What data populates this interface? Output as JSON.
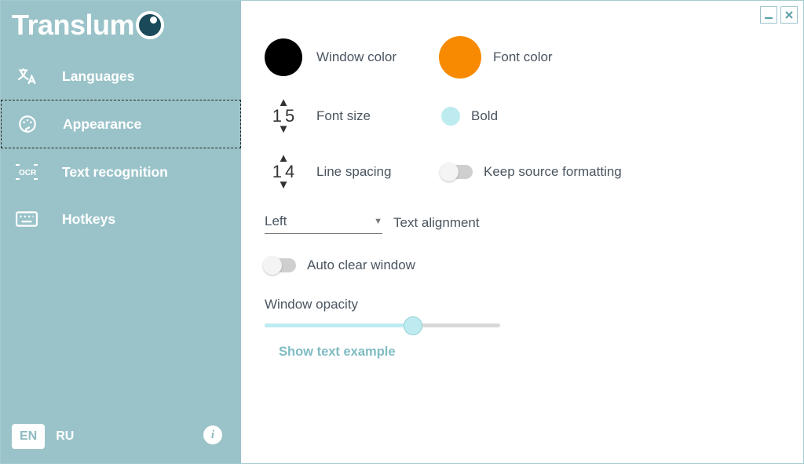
{
  "app": {
    "name": "Translum"
  },
  "sidebar": {
    "items": [
      {
        "label": "Languages"
      },
      {
        "label": "Appearance"
      },
      {
        "label": "Text recognition"
      },
      {
        "label": "Hotkeys"
      }
    ],
    "active_index": 1,
    "lang": {
      "primary": "EN",
      "secondary": "RU"
    }
  },
  "settings": {
    "window_color": {
      "label": "Window color",
      "value": "#000000"
    },
    "font_color": {
      "label": "Font color",
      "value": "#f78a00"
    },
    "font_size": {
      "label": "Font size",
      "value": "15"
    },
    "bold": {
      "label": "Bold",
      "value": false
    },
    "line_spacing": {
      "label": "Line spacing",
      "value": "14"
    },
    "keep_formatting": {
      "label": "Keep source formatting",
      "value": false
    },
    "text_alignment": {
      "label": "Text alignment",
      "value": "Left"
    },
    "auto_clear": {
      "label": "Auto clear window",
      "value": false
    },
    "opacity": {
      "label": "Window opacity",
      "percent": 63
    },
    "show_example": {
      "label": "Show text example"
    }
  }
}
